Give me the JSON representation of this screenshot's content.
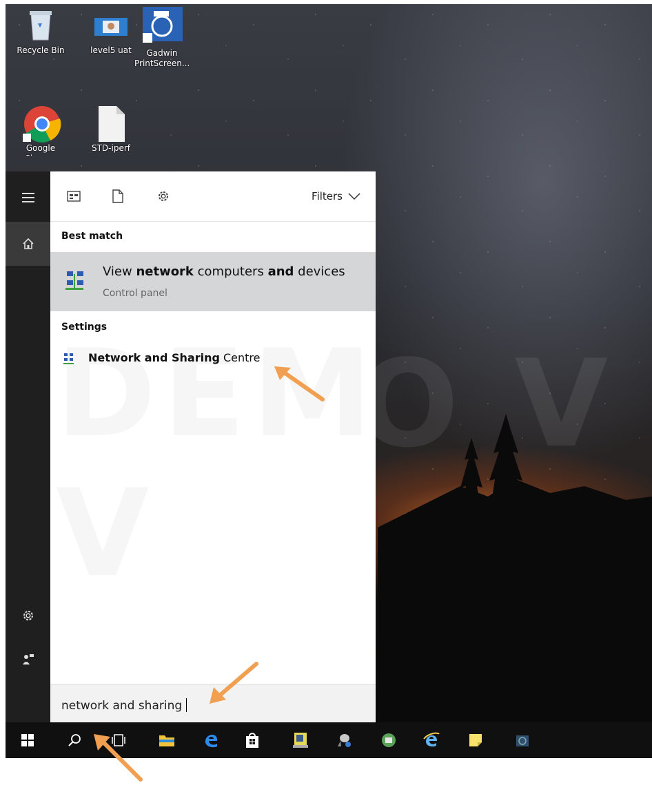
{
  "desktop": {
    "icons": [
      {
        "label": "Recycle Bin"
      },
      {
        "label": "level5 uat"
      },
      {
        "label": "Gadwin PrintScreen..."
      },
      {
        "label": "Google Chrome"
      },
      {
        "label": "STD-iperf"
      }
    ],
    "watermark": "DEMO V"
  },
  "search_panel": {
    "filters_label": "Filters",
    "best_match": {
      "heading": "Best match",
      "title_parts": [
        "View ",
        "network",
        " computers ",
        "and",
        " devices"
      ],
      "subtitle": "Control panel"
    },
    "settings": {
      "heading": "Settings",
      "title_bold": "Network and Sharing",
      "title_rest": " Centre"
    },
    "search_query": "network and sharing"
  },
  "colors": {
    "sidebar": "#1f1f1f",
    "selected_row": "#d4d6d8",
    "taskbar": "#101010",
    "annotation_arrow": "#f0a050"
  }
}
